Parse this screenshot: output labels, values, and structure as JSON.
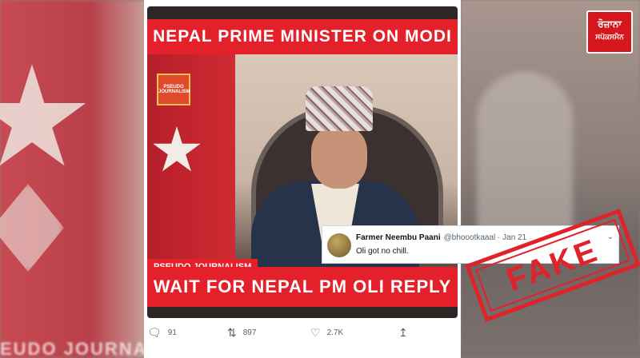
{
  "background": {
    "bottom_text": "EUDO JOURNALISM"
  },
  "brand": {
    "line1": "ਰੋਜ਼ਾਨਾ",
    "line2": "ਸਪੋਕਸਮੈਨ",
    "color": "#d5171d"
  },
  "video": {
    "top_banner": "NEPAL PRIME MINISTER ON MODI JI",
    "bottom_banner": "WAIT FOR NEPAL PM OLI REPLY",
    "watermark_tag": "PSEUDO JOURNALISM",
    "logo_text": "PSEUDO JOURNALISM",
    "banner_color": "#e4202a"
  },
  "tweet_actions": {
    "replies": "91",
    "retweets": "897",
    "likes": "2.7K",
    "icons": [
      "reply-icon",
      "retweet-icon",
      "like-icon",
      "share-icon"
    ]
  },
  "reply_tweet": {
    "name": "Farmer Neembu Paani",
    "handle": "@bhoootkaaal · Jan 21",
    "text": "Oli got no chill."
  },
  "stamp": {
    "label": "FAKE",
    "color": "#e0222a"
  }
}
